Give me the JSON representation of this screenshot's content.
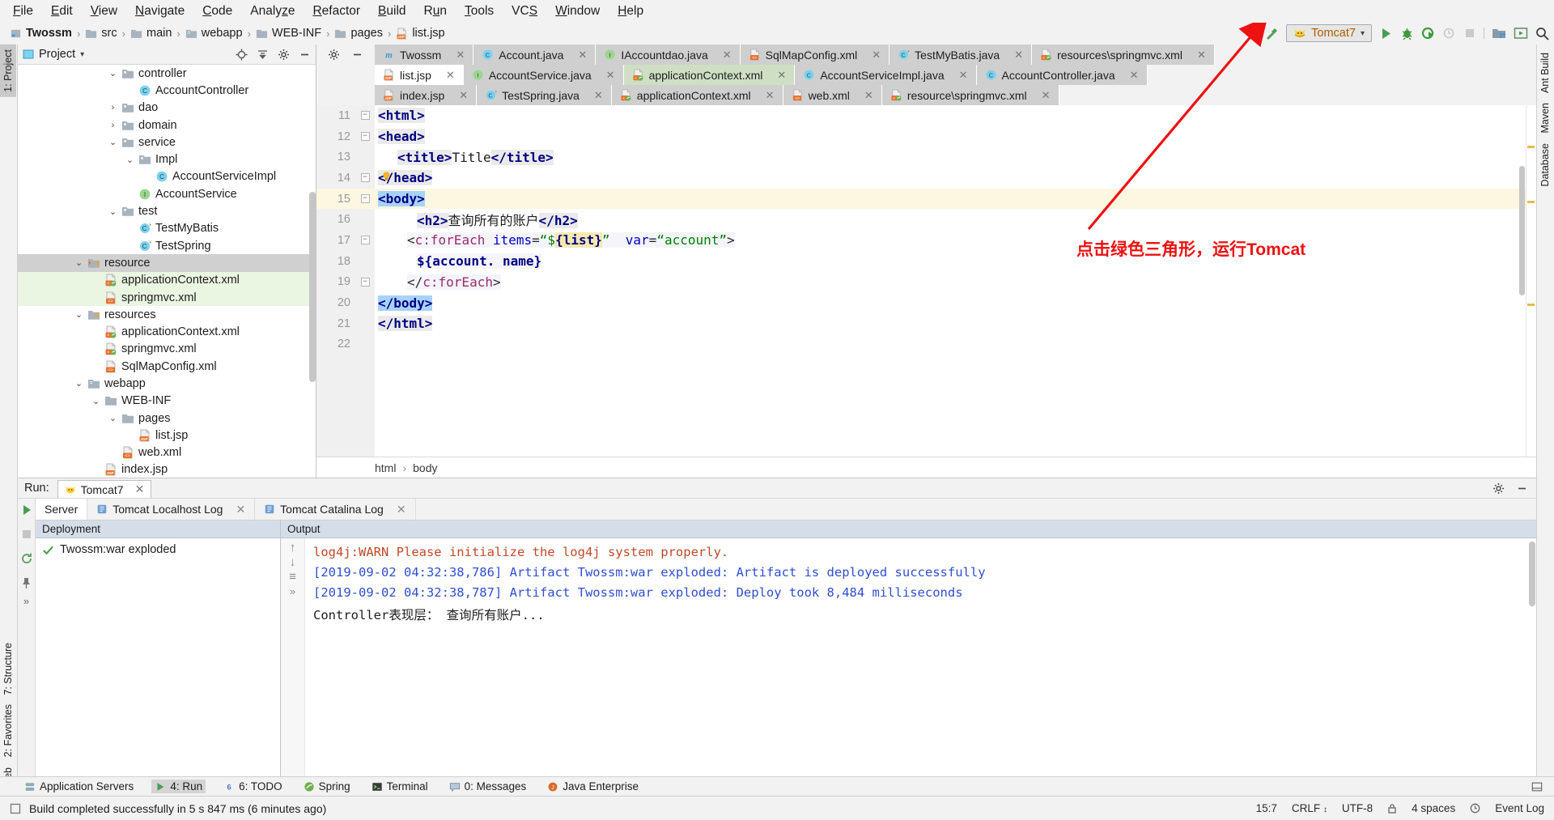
{
  "menu": {
    "items": [
      "File",
      "Edit",
      "View",
      "Navigate",
      "Code",
      "Analyze",
      "Refactor",
      "Build",
      "Run",
      "Tools",
      "VCS",
      "Window",
      "Help"
    ]
  },
  "breadcrumb": {
    "items": [
      {
        "label": "Twossm",
        "icon": "module-icon"
      },
      {
        "label": "src",
        "icon": "folder-icon"
      },
      {
        "label": "main",
        "icon": "folder-icon"
      },
      {
        "label": "webapp",
        "icon": "webapp-folder-icon"
      },
      {
        "label": "WEB-INF",
        "icon": "folder-icon"
      },
      {
        "label": "pages",
        "icon": "folder-icon"
      },
      {
        "label": "list.jsp",
        "icon": "jsp-file-icon"
      }
    ],
    "separator": "›"
  },
  "toolbar": {
    "build_icon": "hammer-icon",
    "run_config": "Tomcat7",
    "run_config_icon": "tomcat-icon",
    "dropdown_icon": "chevron-down-icon",
    "buttons": [
      {
        "name": "run-button",
        "icon": "play-triangle-icon"
      },
      {
        "name": "debug-button",
        "icon": "bug-icon"
      },
      {
        "name": "run-with-coverage-button",
        "icon": "coverage-icon"
      },
      {
        "name": "profile-button",
        "icon": "profiler-icon"
      },
      {
        "name": "stop-button",
        "icon": "stop-square-icon"
      },
      {
        "name": "project-structure-button",
        "icon": "project-structure-icon"
      },
      {
        "name": "update-app-button",
        "icon": "update-app-icon"
      },
      {
        "name": "search-everywhere-button",
        "icon": "search-icon"
      }
    ]
  },
  "left_stripe": {
    "items": [
      {
        "label": "1: Project",
        "selected": true
      },
      {
        "label": "7: Structure",
        "selected": false
      },
      {
        "label": "2: Favorites",
        "selected": false
      },
      {
        "label": "Web",
        "selected": false
      }
    ]
  },
  "right_stripe": {
    "items": [
      {
        "label": "Ant Build"
      },
      {
        "label": "Maven"
      },
      {
        "label": "Database"
      }
    ]
  },
  "project_panel": {
    "title": "Project",
    "title_dropdown": "chevron-down-icon",
    "header_icons": [
      "locate-icon",
      "collapse-all-icon",
      "settings-gear-icon",
      "hide-icon"
    ],
    "tree": [
      {
        "label": "controller",
        "icon": "package-folder-icon",
        "twisty": "expanded",
        "indent": 5
      },
      {
        "label": "AccountController",
        "icon": "java-class-icon",
        "twisty": "none",
        "indent": 6
      },
      {
        "label": "dao",
        "icon": "package-folder-icon",
        "twisty": "collapsed",
        "indent": 5
      },
      {
        "label": "domain",
        "icon": "package-folder-icon",
        "twisty": "collapsed",
        "indent": 5
      },
      {
        "label": "service",
        "icon": "package-folder-icon",
        "twisty": "expanded",
        "indent": 5
      },
      {
        "label": "Impl",
        "icon": "package-folder-icon",
        "twisty": "expanded",
        "indent": 6
      },
      {
        "label": "AccountServiceImpl",
        "icon": "java-class-icon",
        "twisty": "none",
        "indent": 7
      },
      {
        "label": "AccountService",
        "icon": "java-interface-icon",
        "twisty": "none",
        "indent": 6
      },
      {
        "label": "test",
        "icon": "package-folder-icon",
        "twisty": "expanded",
        "indent": 5
      },
      {
        "label": "TestMyBatis",
        "icon": "java-test-class-icon",
        "twisty": "none",
        "indent": 6
      },
      {
        "label": "TestSpring",
        "icon": "java-test-class-icon",
        "twisty": "none",
        "indent": 6
      },
      {
        "label": "resource",
        "icon": "resource-root-folder-icon",
        "twisty": "expanded",
        "indent": 3,
        "state": "selected"
      },
      {
        "label": "applicationContext.xml",
        "icon": "spring-xml-icon",
        "twisty": "none",
        "indent": 4,
        "state": "green"
      },
      {
        "label": "springmvc.xml",
        "icon": "xml-file-icon",
        "twisty": "none",
        "indent": 4,
        "state": "green"
      },
      {
        "label": "resources",
        "icon": "resources-folder-icon",
        "twisty": "expanded",
        "indent": 3
      },
      {
        "label": "applicationContext.xml",
        "icon": "spring-xml-icon",
        "twisty": "none",
        "indent": 4
      },
      {
        "label": "springmvc.xml",
        "icon": "spring-xml-icon",
        "twisty": "none",
        "indent": 4
      },
      {
        "label": "SqlMapConfig.xml",
        "icon": "xml-file-icon",
        "twisty": "none",
        "indent": 4
      },
      {
        "label": "webapp",
        "icon": "webapp-folder-icon",
        "twisty": "expanded",
        "indent": 3
      },
      {
        "label": "WEB-INF",
        "icon": "folder-icon",
        "twisty": "expanded",
        "indent": 4
      },
      {
        "label": "pages",
        "icon": "folder-icon",
        "twisty": "expanded",
        "indent": 5
      },
      {
        "label": "list.jsp",
        "icon": "jsp-file-icon",
        "twisty": "none",
        "indent": 6
      },
      {
        "label": "web.xml",
        "icon": "xml-file-icon",
        "twisty": "none",
        "indent": 5
      },
      {
        "label": "index.jsp",
        "icon": "jsp-file-icon",
        "twisty": "none",
        "indent": 4
      }
    ]
  },
  "editor": {
    "tab_rows": [
      [
        {
          "label": "Twossm",
          "icon": "maven-module-icon",
          "state": "inactive",
          "closable": true
        },
        {
          "label": "Account.java",
          "icon": "java-class-icon",
          "state": "inactive",
          "closable": true
        },
        {
          "label": "IAccountdao.java",
          "icon": "java-interface-icon",
          "state": "inactive",
          "closable": true
        },
        {
          "label": "SqlMapConfig.xml",
          "icon": "xml-file-icon",
          "state": "inactive",
          "closable": true
        },
        {
          "label": "TestMyBatis.java",
          "icon": "java-test-class-icon",
          "state": "inactive",
          "closable": true
        },
        {
          "label": "resources\\springmvc.xml",
          "icon": "spring-xml-icon",
          "state": "inactive",
          "closable": true
        }
      ],
      [
        {
          "label": "list.jsp",
          "icon": "jsp-file-icon",
          "state": "active",
          "closable": true
        },
        {
          "label": "AccountService.java",
          "icon": "java-interface-icon",
          "state": "inactive",
          "closable": true
        },
        {
          "label": "applicationContext.xml",
          "icon": "spring-xml-icon",
          "state": "green",
          "closable": true
        },
        {
          "label": "AccountServiceImpl.java",
          "icon": "java-class-icon",
          "state": "inactive",
          "closable": true
        },
        {
          "label": "AccountController.java",
          "icon": "java-class-icon",
          "state": "inactive",
          "closable": true
        }
      ],
      [
        {
          "label": "index.jsp",
          "icon": "jsp-file-icon",
          "state": "inactive",
          "closable": true
        },
        {
          "label": "TestSpring.java",
          "icon": "java-test-class-icon",
          "state": "inactive",
          "closable": true
        },
        {
          "label": "applicationContext.xml",
          "icon": "spring-xml-icon",
          "state": "inactive",
          "closable": true
        },
        {
          "label": "web.xml",
          "icon": "xml-file-icon",
          "state": "inactive",
          "closable": true
        },
        {
          "label": "resource\\springmvc.xml",
          "icon": "spring-xml-icon",
          "state": "inactive",
          "closable": true
        }
      ]
    ],
    "code_lines": [
      {
        "num": "11",
        "fold": "expanded",
        "indent": 0,
        "tokens": [
          {
            "t": "<html>",
            "k": "tag",
            "hl": "gray"
          }
        ]
      },
      {
        "num": "12",
        "fold": "expanded",
        "indent": 0,
        "tokens": [
          {
            "t": "<head>",
            "k": "tag",
            "hl": "gray"
          }
        ]
      },
      {
        "num": "13",
        "fold": "none",
        "indent": 2,
        "tokens": [
          {
            "t": "<title>",
            "k": "tag",
            "hl": "gray"
          },
          {
            "t": "Title",
            "k": "plain",
            "hl": "none"
          },
          {
            "t": "</title>",
            "k": "tag",
            "hl": "gray"
          }
        ]
      },
      {
        "num": "14",
        "fold": "collapsed-bulb",
        "indent": 0,
        "tokens": [
          {
            "t": "</head>",
            "k": "tag",
            "hl": "gray"
          }
        ]
      },
      {
        "num": "15",
        "fold": "expanded",
        "indent": 0,
        "current": true,
        "tokens": [
          {
            "t": "<body>",
            "k": "tag",
            "hl": "blue"
          }
        ]
      },
      {
        "num": "16",
        "fold": "none",
        "indent": 4,
        "tokens": [
          {
            "t": "<h2>",
            "k": "tag",
            "hl": "gray"
          },
          {
            "t": "查询所有的账户",
            "k": "plain",
            "hl": "none"
          },
          {
            "t": "</h2>",
            "k": "tag",
            "hl": "gray"
          }
        ]
      },
      {
        "num": "17",
        "fold": "expanded",
        "indent": 3,
        "tokens": [
          {
            "t": "<",
            "k": "angle",
            "hl": "el"
          },
          {
            "t": "c:forEach",
            "k": "jspns",
            "hl": "el"
          },
          {
            "t": " ",
            "k": "plain",
            "hl": "el"
          },
          {
            "t": "items",
            "k": "attr",
            "hl": "el"
          },
          {
            "t": "=",
            "k": "angle",
            "hl": "el"
          },
          {
            "t": "“$",
            "k": "str",
            "hl": "el"
          },
          {
            "t": "{list}",
            "k": "eldollar",
            "hl": "yellow"
          },
          {
            "t": "”",
            "k": "str",
            "hl": "el"
          },
          {
            "t": "  ",
            "k": "plain",
            "hl": "el"
          },
          {
            "t": "var",
            "k": "attr",
            "hl": "el"
          },
          {
            "t": "=",
            "k": "angle",
            "hl": "el"
          },
          {
            "t": "“account”",
            "k": "str",
            "hl": "el"
          },
          {
            "t": ">",
            "k": "angle",
            "hl": "el"
          }
        ]
      },
      {
        "num": "18",
        "fold": "none",
        "indent": 4,
        "tokens": [
          {
            "t": "${account. name}",
            "k": "eldollar",
            "hl": "el"
          }
        ]
      },
      {
        "num": "19",
        "fold": "collapsed",
        "indent": 3,
        "tokens": [
          {
            "t": "</",
            "k": "angle",
            "hl": "el"
          },
          {
            "t": "c:forEach",
            "k": "jspns",
            "hl": "el"
          },
          {
            "t": ">",
            "k": "angle",
            "hl": "el"
          }
        ]
      },
      {
        "num": "20",
        "fold": "none",
        "indent": 0,
        "tokens": [
          {
            "t": "</body>",
            "k": "tag",
            "hl": "blue"
          }
        ]
      },
      {
        "num": "21",
        "fold": "none",
        "indent": 0,
        "tokens": [
          {
            "t": "</html>",
            "k": "tag",
            "hl": "gray"
          }
        ]
      },
      {
        "num": "22",
        "fold": "none",
        "indent": 0,
        "tokens": []
      }
    ],
    "breadcrumb": [
      "html",
      "body"
    ],
    "breadcrumb_separator": "›"
  },
  "annotation": {
    "text": "点击绿色三角形，运行Tomcat",
    "color": "#ee1111",
    "arrow": "red-arrow-pointing-to-run-button"
  },
  "run_panel": {
    "title": "Run:",
    "tab": {
      "label": "Tomcat7",
      "icon": "tomcat-icon"
    },
    "header_icons": [
      "settings-gear-icon",
      "hide-icon"
    ],
    "left_tools": [
      "rerun-icon",
      "stop-icon",
      "redeploy-icon",
      "pin-icon",
      "more-icon"
    ],
    "subtabs": [
      {
        "label": "Server",
        "icon": "",
        "active": true
      },
      {
        "label": "Tomcat Localhost Log",
        "icon": "log-icon",
        "active": false
      },
      {
        "label": "Tomcat Catalina Log",
        "icon": "log-icon",
        "active": false
      }
    ],
    "deployment": {
      "header": "Deployment",
      "items": [
        {
          "label": "Twossm:war exploded",
          "status_icon": "green-check-icon"
        }
      ]
    },
    "output": {
      "header": "Output",
      "tools": [
        "scroll-up-icon",
        "scroll-down-icon",
        "soft-wrap-icon",
        "more-icon"
      ],
      "lines": [
        {
          "text": "log4j:WARN Please initialize the log4j system properly.",
          "type": "warn"
        },
        {
          "text": "[2019-09-02 04:32:38,786] Artifact Twossm:war exploded: Artifact is deployed successfully",
          "type": "info"
        },
        {
          "text": "[2019-09-02 04:32:38,787] Artifact Twossm:war exploded: Deploy took 8,484 milliseconds",
          "type": "info"
        },
        {
          "text": "Controller表现层： 查询所有账户...",
          "type": "ctrl"
        }
      ]
    }
  },
  "bottom_bar": {
    "items": [
      {
        "label": "Application Servers",
        "icon": "server-icon",
        "selected": false
      },
      {
        "label": "4: Run",
        "icon": "run-triangle-icon",
        "selected": true
      },
      {
        "label": "6: TODO",
        "icon": "todo-icon",
        "selected": false
      },
      {
        "label": "Spring",
        "icon": "spring-leaf-icon",
        "selected": false
      },
      {
        "label": "Terminal",
        "icon": "terminal-icon",
        "selected": false
      },
      {
        "label": "0: Messages",
        "icon": "messages-icon",
        "selected": false
      },
      {
        "label": "Java Enterprise",
        "icon": "java-ee-icon",
        "selected": false
      }
    ],
    "right_icon": "layout-icon"
  },
  "status_bar": {
    "icon": "build-status-icon",
    "message": "Build completed successfully in 5 s 847 ms (6 minutes ago)",
    "right": {
      "caret": "15:7",
      "line_sep": "CRLF",
      "encoding": "UTF-8",
      "indent": "4 spaces",
      "lock_icon": "lock-icon",
      "event_log": "Event Log",
      "event_log_icon": "event-log-icon"
    }
  }
}
